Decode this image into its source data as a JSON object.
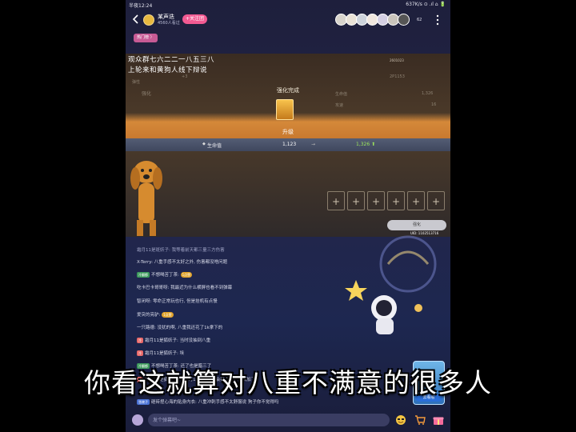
{
  "status_bar": {
    "time": "半夜12:24",
    "network": "637K/s ⊙ .ıl ⌂ 🔋"
  },
  "header": {
    "host_name": "某声迭",
    "host_sub": "4560人看过",
    "follow_label": "+关注团",
    "viewer_count": "62"
  },
  "tag": "热门榜 〉",
  "video": {
    "caption_line1": "观众群七六二二一八五三八",
    "caption_line2": "上轮来和黄狗人线下辩说",
    "top_right": "2601023",
    "bg_row1_left": "+3",
    "bg_row1_right": "2P1153",
    "bg_row2_left": "弹性",
    "bg_row3_left": "强化",
    "bg_stat1_label": "生命值",
    "bg_stat1_value": "1,326",
    "bg_stat2_label": "攻速",
    "bg_stat2_value": "16",
    "popup_title": "强化完成",
    "upgrade_label": "升级",
    "stat_bullet": "◆",
    "stat_label": "生命值",
    "stat_old": "1,123",
    "stat_arrow": "→",
    "stat_new": "1,326 ⬆",
    "slot_plus": "+",
    "enhance_label": "强化",
    "uid": "UID: 1102513716"
  },
  "chat": [
    {
      "text": "霜月11是斑妖子: 我等着前天都三量三方伤害",
      "dim": true
    },
    {
      "text": "X-Terry: 八重手感不太好之外, 伤害都没啥问题"
    },
    {
      "badge": "冷翻都",
      "badge_color": "green",
      "text": "不想喝苦丁茶: ",
      "lv": "1点赞"
    },
    {
      "text": "吃卡巴卡哥哥呀: 我最近为什么横屏也看不到弹幕"
    },
    {
      "text": "智闭呀: 零命正常玩也行, 但是挂机有点慢"
    },
    {
      "text": "爱突的亮驴: ",
      "lv": "1点赞"
    },
    {
      "text": "一只路德: 没犹的啊, 八重我还花了1k拿下的"
    },
    {
      "badge": "冷",
      "badge_color": "red",
      "text": "霜月11是狐妖子: 当时没抽到八重"
    },
    {
      "badge": "冷",
      "badge_color": "red",
      "text": "霜月11是狐妖子: 埃"
    },
    {
      "badge": "冷翻都",
      "badge_color": "green",
      "text": "不想喝苦丁茶: 还了也是腊三了"
    },
    {
      "badge": "冷",
      "badge_color": "red",
      "text": "霜月11是狐妖子: 一个月1k以上大多会搞去手打深渊加了"
    },
    {
      "badge": "弦晓子",
      "badge_color": "blue",
      "text": "砸砖捏心海的贴身内衣: 八重冲刺手感不太舒服说 狗子你不觉得吗"
    }
  ],
  "input": {
    "placeholder": "发个弹幕吧~"
  },
  "promo": {
    "label": "去看看"
  },
  "subtitle": "你看这就算对八重不满意的很多人",
  "colors": {
    "accent_pink": "#f25a92",
    "stat_up_green": "#9ee85c",
    "promo_blue": "#2a6ed8"
  }
}
